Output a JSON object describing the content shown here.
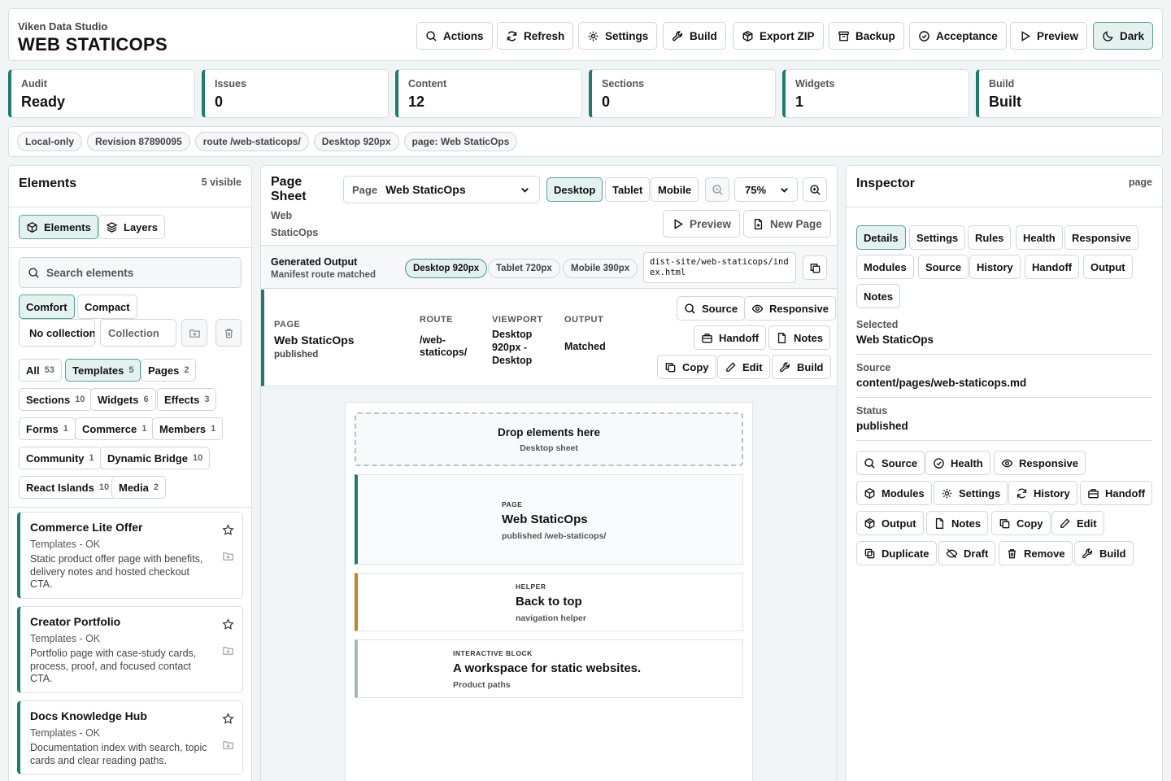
{
  "app": {
    "org": "Viken Data Studio",
    "title": "WEB STATICOPS"
  },
  "toolbar": [
    "Actions",
    "Refresh",
    "Settings",
    "Build",
    "Export ZIP",
    "Backup",
    "Acceptance",
    "Preview",
    "Dark"
  ],
  "stats": [
    {
      "label": "Audit",
      "value": "Ready"
    },
    {
      "label": "Issues",
      "value": "0"
    },
    {
      "label": "Content",
      "value": "12"
    },
    {
      "label": "Sections",
      "value": "0"
    },
    {
      "label": "Widgets",
      "value": "1"
    },
    {
      "label": "Build",
      "value": "Built"
    }
  ],
  "status_chips": [
    "Local-only",
    "Revision 87890095",
    "route /web-staticops/",
    "Desktop 920px",
    "page: Web StaticOps"
  ],
  "elements": {
    "title": "Elements",
    "count": "5 visible",
    "tabs": [
      "Elements",
      "Layers"
    ],
    "search_placeholder": "Search elements",
    "density": [
      "Comfort",
      "Compact"
    ],
    "collection_select": "No collection",
    "collection_placeholder": "Collection",
    "categories": [
      {
        "label": "All",
        "n": "53"
      },
      {
        "label": "Templates",
        "n": "5"
      },
      {
        "label": "Pages",
        "n": "2"
      },
      {
        "label": "Sections",
        "n": "10"
      },
      {
        "label": "Widgets",
        "n": "6"
      },
      {
        "label": "Effects",
        "n": "3"
      },
      {
        "label": "Forms",
        "n": "1"
      },
      {
        "label": "Commerce",
        "n": "1"
      },
      {
        "label": "Members",
        "n": "1"
      },
      {
        "label": "Community",
        "n": "1"
      },
      {
        "label": "Dynamic Bridge",
        "n": "10"
      },
      {
        "label": "React Islands",
        "n": "10"
      },
      {
        "label": "Media",
        "n": "2"
      }
    ],
    "cards": [
      {
        "title": "Commerce Lite Offer",
        "sub": "Templates - OK",
        "desc": "Static product offer page with benefits, delivery notes and hosted checkout CTA."
      },
      {
        "title": "Creator Portfolio",
        "sub": "Templates - OK",
        "desc": "Portfolio page with case-study cards, process, proof, and focused contact CTA."
      },
      {
        "title": "Docs Knowledge Hub",
        "sub": "Templates - OK",
        "desc": "Documentation index with search, topic cards and clear reading paths."
      }
    ]
  },
  "sheet": {
    "title_a": "Page",
    "title_b": "Sheet",
    "sub_a": "Web",
    "sub_b": "StaticOps",
    "page_select_label": "Page",
    "page_select_value": "Web StaticOps",
    "viewports": [
      "Desktop",
      "Tablet",
      "Mobile"
    ],
    "zoom": "75%",
    "preview": "Preview",
    "new_page": "New Page",
    "output_title": "Generated Output",
    "output_sub": "Manifest route matched",
    "output_chips": [
      "Desktop 920px",
      "Tablet 720px",
      "Mobile 390px"
    ],
    "output_path": "dist-site/web-staticops/index.html",
    "row": {
      "kind": "PAGE",
      "name": "Web StaticOps",
      "state": "published",
      "route_h": "ROUTE",
      "route_v": "/web-staticops/",
      "viewport_h": "VIEWPORT",
      "viewport_v": "Desktop 920px - Desktop",
      "output_h": "OUTPUT",
      "output_v": "Matched",
      "actions": [
        "Source",
        "Responsive",
        "Handoff",
        "Notes",
        "Copy",
        "Edit",
        "Build"
      ]
    },
    "canvas": {
      "drop_title": "Drop elements here",
      "drop_sub": "Desktop sheet",
      "blocks": [
        {
          "kind": "PAGE",
          "title": "Web StaticOps",
          "sub": "published /web-staticops/",
          "color": "#1f7a70"
        },
        {
          "kind": "HELPER",
          "title": "Back to top",
          "sub": "navigation helper",
          "color": "#c0842e"
        },
        {
          "kind": "INTERACTIVE BLOCK",
          "title": "A workspace for static websites.",
          "sub": "Product paths",
          "color": "#a9b7bd"
        }
      ]
    }
  },
  "inspector": {
    "title": "Inspector",
    "scope": "page",
    "tabs": [
      "Details",
      "Settings",
      "Rules",
      "Health",
      "Responsive",
      "Modules",
      "Source",
      "History",
      "Handoff",
      "Output",
      "Notes"
    ],
    "fields": [
      {
        "label": "Selected",
        "value": "Web StaticOps"
      },
      {
        "label": "Source",
        "value": "content/pages/web-staticops.md"
      },
      {
        "label": "Status",
        "value": "published"
      }
    ],
    "actions": [
      "Source",
      "Health",
      "Responsive",
      "Modules",
      "Settings",
      "History",
      "Handoff",
      "Output",
      "Notes",
      "Copy",
      "Edit",
      "Duplicate",
      "Draft",
      "Remove",
      "Build"
    ]
  },
  "colors": {
    "accent": "#1f7a70",
    "helper": "#c0842e",
    "muted": "#a9b7bd"
  }
}
